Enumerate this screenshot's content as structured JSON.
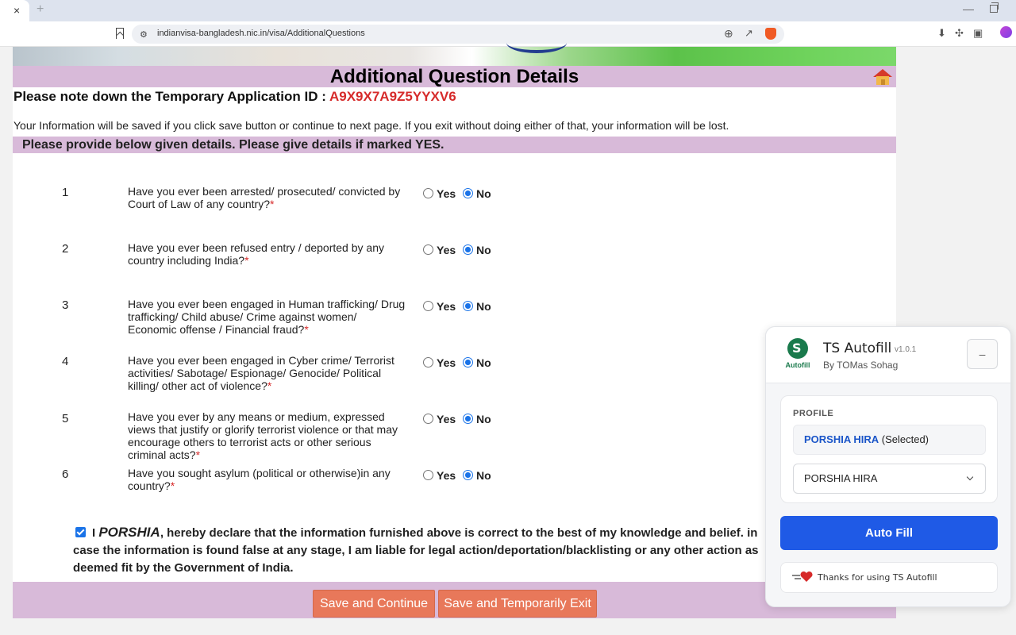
{
  "browser": {
    "tab_close": "×",
    "new_tab": "+",
    "url": "indianvisa-bangladesh.nic.in/visa/AdditionalQuestions"
  },
  "page": {
    "title": "Additional Question Details",
    "temp_id_label": "Please note down the Temporary Application ID :",
    "temp_id": "A9X9X7A9Z5YYXV6",
    "info_text": "Your Information will be saved if you click save button or continue to next page. If you exit without doing either of that, your information will be lost.",
    "subheader": "Please provide below given details. Please give details if marked YES.",
    "required_mark": "*",
    "yes_label": "Yes",
    "no_label": "No",
    "questions": [
      {
        "num": "1",
        "text": "Have you ever been arrested/ prosecuted/ convicted by Court of Law of any country?",
        "answer": "No"
      },
      {
        "num": "2",
        "text": "Have you ever been refused entry / deported by any country including India?",
        "answer": "No"
      },
      {
        "num": "3",
        "text": "Have you ever been engaged in Human trafficking/ Drug trafficking/ Child abuse/ Crime against women/ Economic offense / Financial fraud?",
        "answer": "No"
      },
      {
        "num": "4",
        "text": "Have you ever been engaged in Cyber crime/ Terrorist activities/ Sabotage/ Espionage/ Genocide/ Political killing/ other act of violence?",
        "answer": "No"
      },
      {
        "num": "5",
        "text": "Have you ever by any means or medium, expressed views that justify or glorify terrorist violence or that may encourage others to terrorist acts or other serious criminal acts?",
        "answer": "No"
      },
      {
        "num": "6",
        "text": "Have you sought asylum (political or otherwise)in any country?",
        "answer": "No"
      }
    ],
    "declaration": {
      "checked": true,
      "prefix": "I",
      "name": "PORSHIA",
      "text": ", hereby declare that the information furnished above is correct to the best of my knowledge and belief. in case the information is found false at any stage, I am liable for legal action/deportation/blacklisting or any other action as deemed fit by the Government of India."
    },
    "save_continue": "Save and Continue",
    "save_exit": "Save and Temporarily Exit"
  },
  "extension": {
    "logo_label": "Autofill",
    "name": "TS Autofill",
    "version": "v1.0.1",
    "author": "By TOMas Sohag",
    "minimize": "–",
    "profile_label": "PROFILE",
    "selected_name": "PORSHIA HIRA",
    "selected_suffix": "(Selected)",
    "dropdown_value": "PORSHIA HIRA",
    "autofill_button": "Auto Fill",
    "thanks_text": "Thanks for using TS Autofill"
  },
  "colors": {
    "accent_purple": "#d8bad9",
    "temp_id_red": "#d62a2a",
    "button_orange": "#e8785a",
    "extension_blue": "#1f5ae6"
  }
}
